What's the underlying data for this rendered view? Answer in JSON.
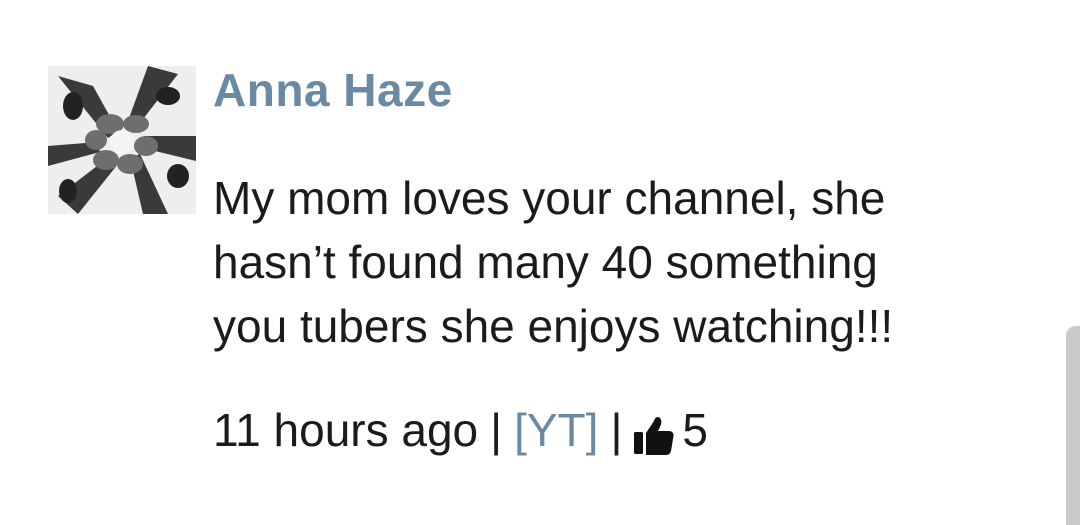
{
  "comment": {
    "author": "Anna Haze",
    "body_lines": [
      "My mom loves your channel, she",
      "hasn’t found many 40 something",
      "you tubers she enjoys watching!!!"
    ],
    "timestamp": "11 hours ago",
    "separator": "|",
    "source_link": "[YT]",
    "like_icon": "thumbs-up-icon",
    "like_count": "5"
  },
  "colors": {
    "author": "#6a8aa3",
    "link": "#6a8aa3",
    "text": "#1b1b1b",
    "scrollbar": "#c9c9c9"
  }
}
